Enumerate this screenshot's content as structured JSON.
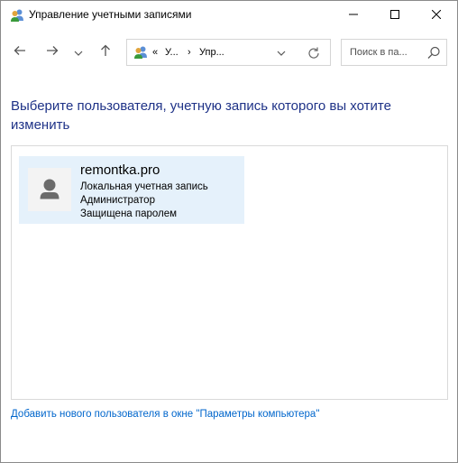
{
  "window": {
    "title": "Управление учетными записями",
    "icon": "users-icon"
  },
  "navigation": {
    "back_icon": "arrow-left-icon",
    "forward_icon": "arrow-right-icon",
    "recent_icon": "chevron-down-icon",
    "up_icon": "arrow-up-icon"
  },
  "address_bar": {
    "overflow": "«",
    "segment_1": "У...",
    "separator": "›",
    "segment_2": "Упр..."
  },
  "search": {
    "placeholder": "Поиск в па..."
  },
  "heading": "Выберите пользователя, учетную запись которого вы хотите изменить",
  "users": [
    {
      "name": "remontka.pro",
      "account_type": "Локальная учетная запись",
      "role": "Администратор",
      "protection": "Защищена паролем"
    }
  ],
  "add_user_link": "Добавить нового пользователя в окне \"Параметры компьютера\"",
  "colors": {
    "heading": "#1e3287",
    "link": "#0066cc",
    "selected_tile": "#e5f1fb"
  }
}
